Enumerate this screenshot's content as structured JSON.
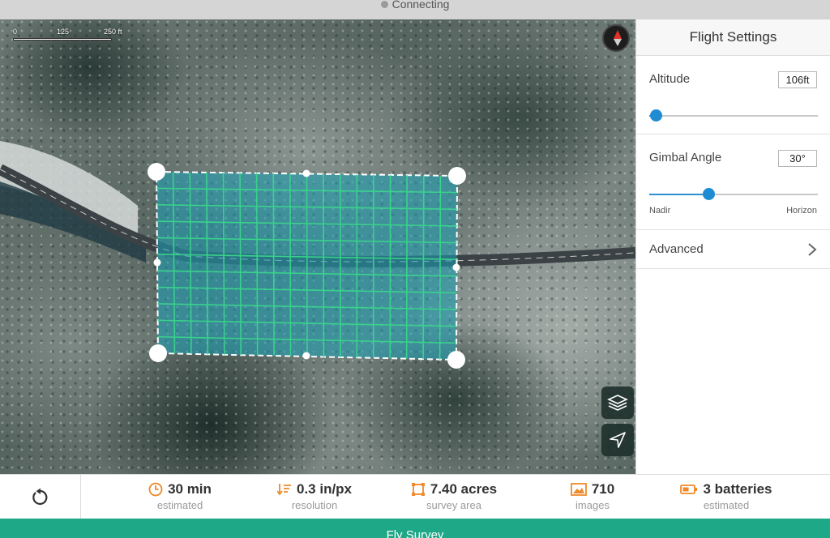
{
  "status": {
    "text": "Connecting"
  },
  "map": {
    "scale_labels": [
      "0",
      "125",
      "250 ft"
    ],
    "layers_icon": "layers-icon",
    "locate_icon": "location-arrow-icon",
    "compass_icon": "compass-icon"
  },
  "panel": {
    "title": "Flight Settings",
    "altitude": {
      "label": "Altitude",
      "value": "106ft",
      "fraction": 0.04
    },
    "gimbal": {
      "label": "Gimbal Angle",
      "value": "30°",
      "fraction": 0.35,
      "min_label": "Nadir",
      "max_label": "Horizon"
    },
    "advanced": {
      "label": "Advanced",
      "icon": "chevron-right-icon"
    }
  },
  "stats": [
    {
      "icon": "clock-icon",
      "value": "30 min",
      "sub": "estimated"
    },
    {
      "icon": "resolution-icon",
      "value": "0.3 in/px",
      "sub": "resolution"
    },
    {
      "icon": "survey-area-icon",
      "value": "7.40 acres",
      "sub": "survey area"
    },
    {
      "icon": "image-icon",
      "value": "710",
      "sub": "images"
    },
    {
      "icon": "battery-icon",
      "value": "3 batteries",
      "sub": "estimated"
    }
  ],
  "reset_icon": "reset-icon",
  "fly_button": {
    "label": "Fly Survey"
  },
  "colors": {
    "accent": "#1ea887",
    "slider": "#1f8bd2",
    "stat_icon": "#f0892a",
    "grid": "#35d38a"
  }
}
